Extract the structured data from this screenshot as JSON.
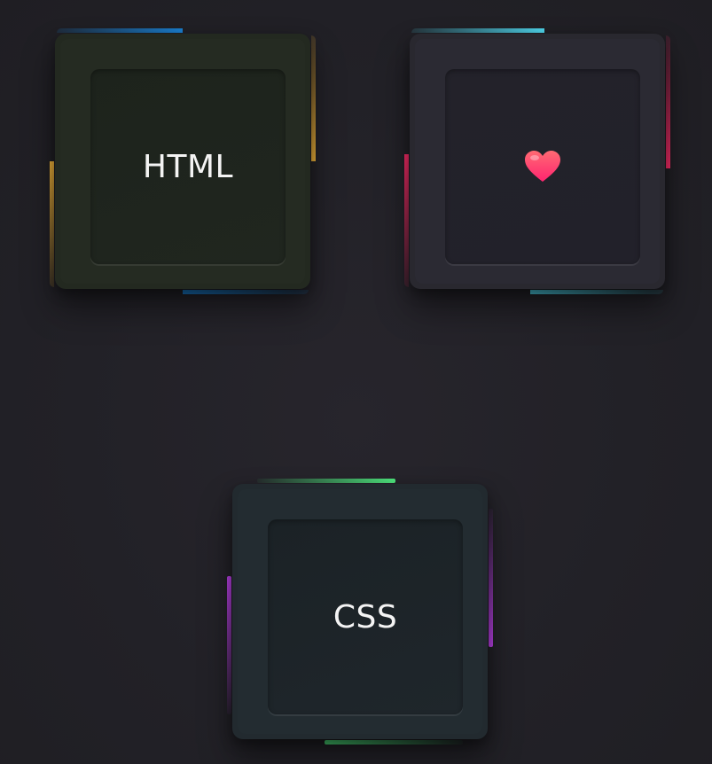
{
  "tiles": [
    {
      "id": "html",
      "label": "HTML",
      "accent_primary": "#1a7fd0",
      "accent_secondary": "#f0b33a"
    },
    {
      "id": "heart",
      "icon": "heart-icon",
      "accent_primary": "#4fd5ec",
      "accent_secondary": "#ff2d6a"
    },
    {
      "id": "css",
      "label": "CSS",
      "accent_primary": "#4fe87f",
      "accent_secondary": "#c043ee"
    }
  ]
}
